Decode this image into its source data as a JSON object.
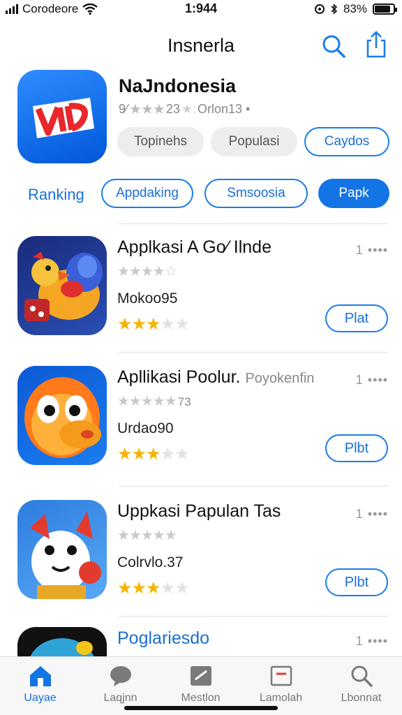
{
  "status_bar": {
    "carrier": "Corodeore",
    "time": "1:944",
    "battery": "83%",
    "battery_level": 0.83
  },
  "nav": {
    "title": "Insnerla"
  },
  "hero": {
    "name": "NaJndonesia",
    "rating_prefix": "9⁄",
    "rating_count": "23",
    "subtitle_tail": "Orlon13 •",
    "pills": [
      "Topinehs",
      "Populasi",
      "Caydos"
    ]
  },
  "ranking": {
    "label": "Ranking",
    "pills": [
      "Appdaking",
      "Smsoosia",
      "Papk"
    ]
  },
  "apps": [
    {
      "name": "Applkasi A Go⁄ Ilnde",
      "extra": "",
      "rank": "1 ••••",
      "gray_count": "",
      "sub": "Mokoo95",
      "gold_stars": 2.5,
      "button": "Plat",
      "colors": [
        "#1a2b7a",
        "#f5a623"
      ]
    },
    {
      "name": "Apllikasi Poolur.",
      "extra": "Poyokenfin",
      "rank": "1 ••••",
      "gray_count": "73",
      "sub": "Urdao90",
      "gold_stars": 2.5,
      "button": "Plbt",
      "colors": [
        "#0d59d6",
        "#ff7a1a"
      ]
    },
    {
      "name": "Uppkasi Papulan Tas",
      "extra": "",
      "rank": "1 ••••",
      "gray_count": "",
      "sub": "Colrvlo.37",
      "gold_stars": 3,
      "button": "Plbt",
      "colors": [
        "#2d7de0",
        "#e23b2e"
      ]
    },
    {
      "name": "Poglariesdo",
      "extra": "",
      "rank": "1 ••••",
      "gray_count": "",
      "sub": "",
      "gold_stars": 0,
      "button": "",
      "colors": [
        "#111111",
        "#2ea3d8"
      ]
    }
  ],
  "tabs": [
    {
      "label": "Uayae",
      "icon": "home-icon",
      "active": true
    },
    {
      "label": "Laqjnn",
      "icon": "chat-icon",
      "active": false
    },
    {
      "label": "Mestlon",
      "icon": "news-icon",
      "active": false
    },
    {
      "label": "Lamolah",
      "icon": "mail-icon",
      "active": false
    },
    {
      "label": "Lbonnat",
      "icon": "search-icon",
      "active": false
    }
  ],
  "colors": {
    "accent": "#1374e6",
    "star": "#f4b400"
  }
}
